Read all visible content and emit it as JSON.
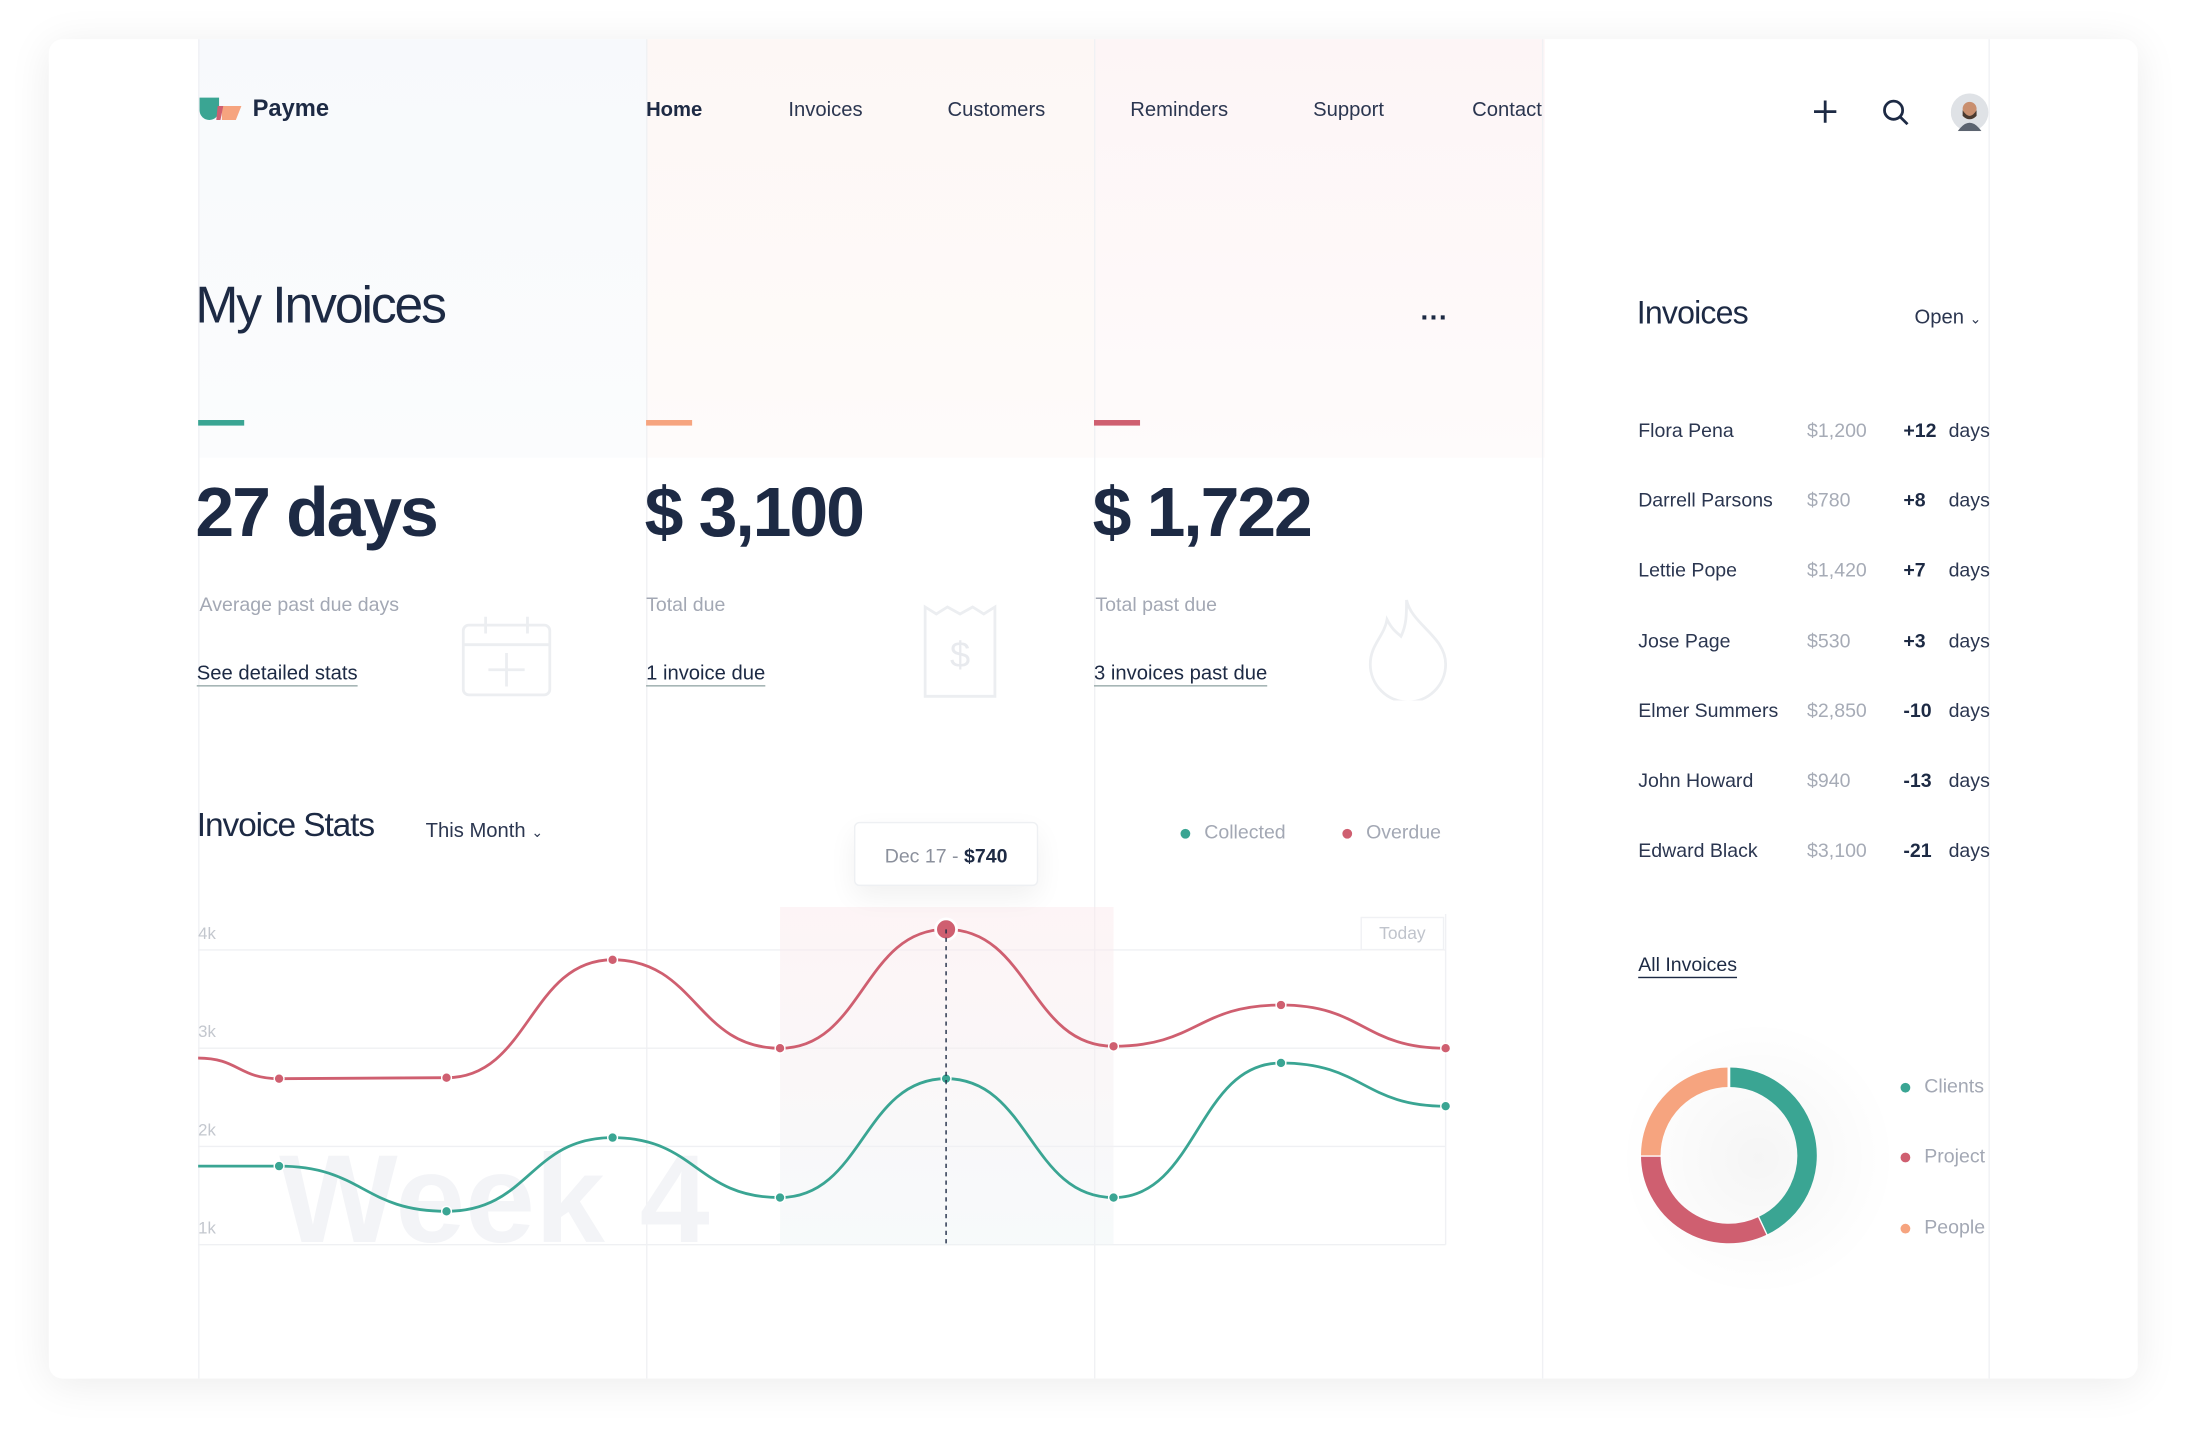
{
  "brand": {
    "name": "Payme",
    "colors": {
      "teal": "#3aa593",
      "peach": "#f6a47f",
      "red": "#cf5f70",
      "navy": "#1d2a44"
    }
  },
  "nav": {
    "items": [
      "Home",
      "Invoices",
      "Customers",
      "Reminders",
      "Support",
      "Contact"
    ],
    "active": "Home"
  },
  "header_icons": [
    "plus-icon",
    "search-icon",
    "avatar"
  ],
  "page": {
    "title": "My Invoices",
    "more": "..."
  },
  "stats": [
    {
      "value": "27 days",
      "label": "Average past due days",
      "link": "See detailed stats",
      "icon": "calendar-icon",
      "color": "#3aa593"
    },
    {
      "value": "$ 3,100",
      "label": "Total due",
      "link": "1 invoice due",
      "icon": "receipt-dollar-icon",
      "color": "#f6a47f"
    },
    {
      "value": "$ 1,722",
      "label": "Total past due",
      "link": "3 invoices past due",
      "icon": "flame-icon",
      "color": "#cf5f70"
    }
  ],
  "invoice_stats": {
    "title": "Invoice Stats",
    "period": "This Month",
    "tooltip": {
      "date": "Dec 17 -",
      "amount": "$740"
    },
    "today_label": "Today",
    "watermark": "Week 4"
  },
  "chart_data": {
    "type": "line",
    "x": [
      0,
      1,
      2,
      3,
      4,
      5,
      6,
      7,
      8
    ],
    "yticks": [
      "1k",
      "2k",
      "3k",
      "4k"
    ],
    "ylim": [
      1000,
      4000
    ],
    "grid": true,
    "legend_position": "top-right",
    "highlight_index": 5,
    "series": [
      {
        "name": "Collected",
        "color": "#3aa593",
        "values": [
          1800,
          1800,
          1340,
          2090,
          1480,
          2690,
          1480,
          2850,
          2410
        ]
      },
      {
        "name": "Overdue",
        "color": "#cf5f70",
        "values": [
          2900,
          2690,
          2700,
          3900,
          3000,
          4210,
          3020,
          3440,
          3000
        ]
      }
    ]
  },
  "sidebar": {
    "title": "Invoices",
    "filter": "Open",
    "rows": [
      {
        "name": "Flora Pena",
        "amount": "$1,200",
        "days": "+12",
        "unit": "days"
      },
      {
        "name": "Darrell Parsons",
        "amount": "$780",
        "days": "+8",
        "unit": "days"
      },
      {
        "name": "Lettie Pope",
        "amount": "$1,420",
        "days": "+7",
        "unit": "days"
      },
      {
        "name": "Jose Page",
        "amount": "$530",
        "days": "+3",
        "unit": "days"
      },
      {
        "name": "Elmer Summers",
        "amount": "$2,850",
        "days": "-10",
        "unit": "days"
      },
      {
        "name": "John Howard",
        "amount": "$940",
        "days": "-13",
        "unit": "days"
      },
      {
        "name": "Edward Black",
        "amount": "$3,100",
        "days": "-21",
        "unit": "days"
      }
    ],
    "all_link": "All Invoices",
    "donut": {
      "type": "pie",
      "segments": [
        {
          "name": "Clients",
          "value": 43,
          "color": "#3aa593"
        },
        {
          "name": "Project",
          "value": 32,
          "color": "#cf5f70"
        },
        {
          "name": "People",
          "value": 25,
          "color": "#f6a47f"
        }
      ]
    }
  }
}
